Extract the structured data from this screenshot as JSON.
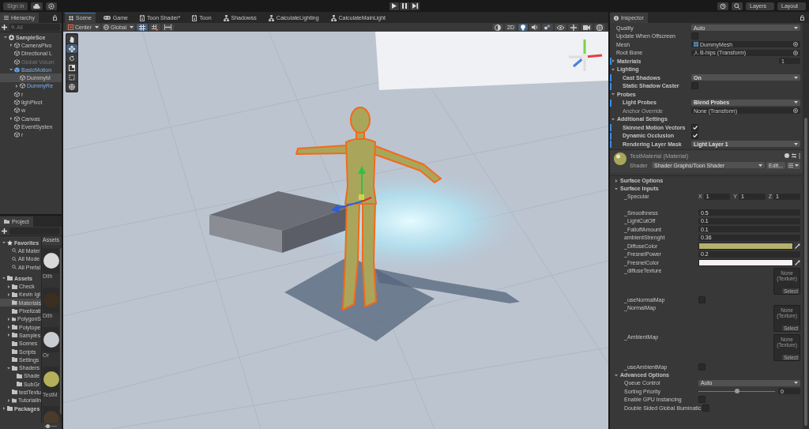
{
  "top_bar": {
    "sign_in": "Sign in",
    "layers": "Layers",
    "layout": "Layout"
  },
  "hierarchy": {
    "title": "Hierarchy",
    "search_placeholder": "All",
    "items": [
      {
        "label": "SampleSce",
        "kind": "scene",
        "expanded": true,
        "selected": false,
        "disabled": false,
        "children": [
          {
            "label": "CameraPivo",
            "kind": "object",
            "expanded": false,
            "selected": false,
            "disabled": false
          },
          {
            "label": "Directional L",
            "kind": "object",
            "selected": false,
            "disabled": false
          },
          {
            "label": "Global Volum",
            "kind": "object",
            "selected": false,
            "disabled": true
          },
          {
            "label": "BasicMotion",
            "kind": "prefab",
            "expanded": true,
            "selected": false,
            "disabled": false,
            "children": [
              {
                "label": "DummyM",
                "kind": "object",
                "selected": true,
                "disabled": false
              },
              {
                "label": "DummyRe",
                "kind": "prefab-part",
                "expanded": false,
                "selected": false,
                "disabled": false
              }
            ]
          },
          {
            "label": "r",
            "kind": "object",
            "selected": false,
            "disabled": false
          },
          {
            "label": "lighPivot",
            "kind": "object",
            "selected": false,
            "disabled": false
          },
          {
            "label": "w",
            "kind": "object",
            "selected": false,
            "disabled": false
          },
          {
            "label": "Canvas",
            "kind": "object",
            "expanded": false,
            "selected": false,
            "disabled": false
          },
          {
            "label": "EventSysten",
            "kind": "object",
            "selected": false,
            "disabled": false
          },
          {
            "label": "r",
            "kind": "object",
            "selected": false,
            "disabled": false
          }
        ]
      }
    ]
  },
  "project": {
    "title": "Project",
    "tree": [
      {
        "label": "Favorites",
        "kind": "favorites",
        "expanded": true,
        "selected": false,
        "children": [
          {
            "label": "All Mater",
            "kind": "search",
            "selected": false
          },
          {
            "label": "All Mode",
            "kind": "search",
            "selected": false
          },
          {
            "label": "All Prefal",
            "kind": "search",
            "selected": false
          }
        ]
      },
      {
        "label": "Assets",
        "kind": "folder",
        "expanded": true,
        "selected": false,
        "children": [
          {
            "label": "Check",
            "kind": "folder",
            "expanded": false,
            "selected": false
          },
          {
            "label": "Kevin Igl",
            "kind": "folder",
            "expanded": false,
            "selected": false
          },
          {
            "label": "Materials",
            "kind": "folder",
            "selected": true
          },
          {
            "label": "Pixelizati",
            "kind": "folder",
            "selected": false
          },
          {
            "label": "PolygonS",
            "kind": "folder",
            "expanded": false,
            "selected": false
          },
          {
            "label": "Polytope",
            "kind": "folder",
            "expanded": false,
            "selected": false
          },
          {
            "label": "Samples",
            "kind": "folder",
            "expanded": false,
            "selected": false
          },
          {
            "label": "Scenes",
            "kind": "folder",
            "selected": false
          },
          {
            "label": "Scripts",
            "kind": "folder",
            "selected": false
          },
          {
            "label": "Settings",
            "kind": "folder",
            "selected": false
          },
          {
            "label": "Shaders",
            "kind": "folder",
            "expanded": true,
            "selected": false,
            "children": [
              {
                "label": "Shade",
                "kind": "folder",
                "selected": false
              },
              {
                "label": "SubGr",
                "kind": "folder",
                "selected": false
              }
            ]
          },
          {
            "label": "testTextu",
            "kind": "folder",
            "selected": false
          },
          {
            "label": "TutorialIn",
            "kind": "folder",
            "expanded": false,
            "selected": false
          }
        ]
      },
      {
        "label": "Packages",
        "kind": "folder",
        "expanded": false,
        "selected": false
      }
    ],
    "zoom": {
      "level": 0.3
    },
    "grid_title": "Assets",
    "assets": [
      {
        "label": "Dith",
        "color": "#d9d9d9"
      },
      {
        "label": "Dith",
        "color": "#3b2f22"
      },
      {
        "label": "Or",
        "color": "#c9ccd1"
      },
      {
        "label": "TestM",
        "color": "#b4b15a"
      },
      {
        "color": "#4a3b2b"
      }
    ]
  },
  "scene": {
    "tabs": [
      {
        "label": "Scene",
        "kind": "scene",
        "selected": true
      },
      {
        "label": "Game",
        "kind": "game",
        "selected": false
      },
      {
        "label": "Toon Shader*",
        "kind": "graph",
        "selected": false
      },
      {
        "label": "Toon",
        "kind": "graph",
        "selected": false
      },
      {
        "label": "Shadowss",
        "kind": "subgraph",
        "selected": false
      },
      {
        "label": "CalculateLighting",
        "kind": "subgraph",
        "selected": false
      },
      {
        "label": "CalculateMainLight",
        "kind": "subgraph",
        "selected": false
      }
    ],
    "pivot": "Center",
    "space": "Global",
    "mode_2d": "2D"
  },
  "inspector": {
    "title": "Inspector",
    "renderer_rows": [
      {
        "kind": "dropdown",
        "label": "Quality",
        "value": "Auto",
        "overridden": false
      },
      {
        "kind": "checkbox",
        "label": "Update When Offscreen",
        "checked": false,
        "overridden": false
      },
      {
        "kind": "mesh-object",
        "label": "Mesh",
        "value": "DummyMesh",
        "overridden": false
      },
      {
        "kind": "transform-object",
        "label": "Root Bone",
        "value": "B-hips (Transform)",
        "overridden": false
      },
      {
        "kind": "count",
        "label": "Materials",
        "value": "1",
        "expanded": false,
        "overridden": true
      },
      {
        "kind": "header",
        "label": "Lighting",
        "expanded": true,
        "children": [
          {
            "kind": "dropdown",
            "label": "Cast Shadows",
            "value": "On",
            "overridden": true
          },
          {
            "kind": "checkbox",
            "label": "Static Shadow Caster",
            "checked": false,
            "overridden": true
          }
        ]
      },
      {
        "kind": "header",
        "label": "Probes",
        "expanded": true,
        "children": [
          {
            "kind": "dropdown",
            "label": "Light Probes",
            "value": "Blend Probes",
            "overridden": true
          },
          {
            "kind": "object",
            "label": "Anchor Override",
            "value": "None (Transform)",
            "overridden": false
          }
        ]
      },
      {
        "kind": "header",
        "label": "Additional Settings",
        "expanded": true,
        "children": [
          {
            "kind": "checkbox",
            "label": "Skinned Motion Vectors",
            "checked": true,
            "overridden": true
          },
          {
            "kind": "checkbox",
            "label": "Dynamic Occlusion",
            "checked": true,
            "overridden": true
          },
          {
            "kind": "dropdown",
            "label": "Rendering Layer Mask",
            "value": "Light Layer 1",
            "overridden": true
          }
        ]
      }
    ],
    "material": {
      "name": "TestMaterial (Material)",
      "shader_label": "Shader",
      "shader": "Shader Graphs/Toon Shader",
      "edit": "Edit..."
    },
    "material_rows": [
      {
        "kind": "section",
        "label": "Surface Options",
        "expanded": false
      },
      {
        "kind": "section",
        "label": "Surface Inputs",
        "expanded": true,
        "children": [
          {
            "kind": "vector",
            "label": "_Specular",
            "components": [
              {
                "axis": "X",
                "value": "1"
              },
              {
                "axis": "Y",
                "value": "1"
              },
              {
                "axis": "Z",
                "value": "1"
              }
            ]
          },
          {
            "kind": "number",
            "label": "_Smoothness",
            "value": "0.5"
          },
          {
            "kind": "number",
            "label": "_LightCutOff",
            "value": "0.1"
          },
          {
            "kind": "number",
            "label": "_FalloffAmount",
            "value": "0.1"
          },
          {
            "kind": "number",
            "label": "ambientStrenght",
            "value": "0.36"
          },
          {
            "kind": "color",
            "label": "_DiffuseColor",
            "color": "#b5b26d"
          },
          {
            "kind": "number",
            "label": "_FresnelPower",
            "value": "0.2"
          },
          {
            "kind": "color",
            "label": "_FresnelColor",
            "color": "#f7f1f1"
          },
          {
            "kind": "texture",
            "label": "_diffuseTexture",
            "value": "None (Texture)",
            "button": "Select"
          },
          {
            "kind": "checkbox",
            "label": "_useNormalMap",
            "checked": false
          },
          {
            "kind": "texture",
            "label": "_NormalMap",
            "value": "None (Texture)",
            "button": "Select"
          },
          {
            "kind": "texture",
            "label": "_AmbientMap",
            "value": "None (Texture)",
            "button": "Select"
          },
          {
            "kind": "checkbox",
            "label": "_useAmbientMap",
            "checked": false
          }
        ]
      },
      {
        "kind": "section",
        "label": "Advanced Options",
        "expanded": true,
        "children": [
          {
            "kind": "dropdown",
            "label": "Queue Control",
            "value": "Auto"
          },
          {
            "kind": "slider",
            "label": "Sorting Priority",
            "level": 0.5,
            "value": "0"
          },
          {
            "kind": "checkbox",
            "label": "Enable GPU Instancing",
            "checked": false
          },
          {
            "kind": "checkbox",
            "label": "Double Sided Global Illuminatic",
            "checked": false
          }
        ]
      }
    ]
  }
}
